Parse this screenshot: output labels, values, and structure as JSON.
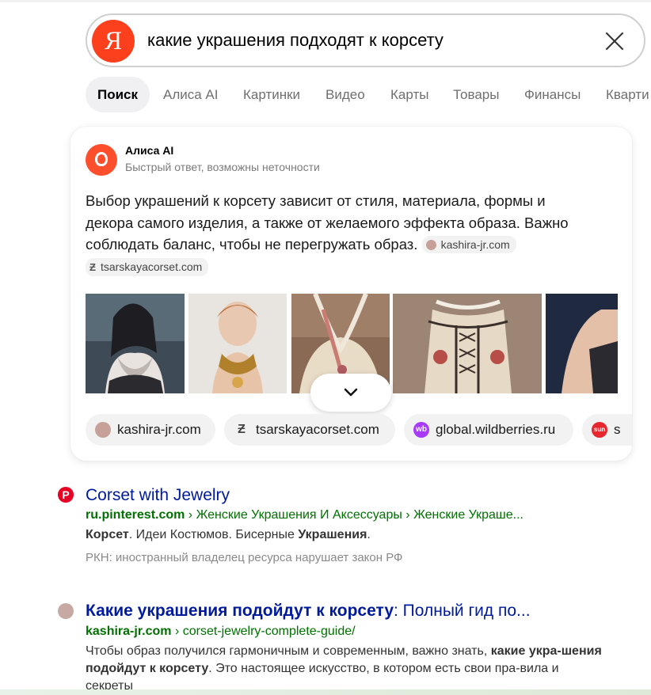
{
  "search": {
    "logo": "Я",
    "query": "какие украшения подходят к корсету"
  },
  "tabs": [
    "Поиск",
    "Алиса AI",
    "Картинки",
    "Видео",
    "Карты",
    "Товары",
    "Финансы",
    "Кварти"
  ],
  "alice": {
    "title": "Алиса AI",
    "subtitle": "Быстрый ответ, возможны неточности",
    "answer": "Выбор украшений к корсету зависит от стиля, материала, формы и декора самого изделия, а также от желаемого эффекта образа. Важно соблюдать баланс, чтобы не перегружать образ.",
    "inline_sources": [
      "kashira-jr.com",
      "tsarskayacorset.com"
    ],
    "sources": [
      "kashira-jr.com",
      "tsarskayacorset.com",
      "global.wildberries.ru",
      "s"
    ],
    "source_icons": [
      "kashira-favicon",
      "z-logo-icon",
      "wb-icon",
      "sunlight-icon"
    ],
    "source_icon_text": [
      "",
      "Ƶ",
      "wb",
      "sun"
    ]
  },
  "results": [
    {
      "icon": "pinterest-icon",
      "icon_text": "P",
      "title": "Corset with Jewelry",
      "url_domain": "ru.pinterest.com",
      "url_path": " › Женские Украшения И Аксессуары › Женские Украше...",
      "snippet_parts": [
        "Корсет",
        ". Идеи Костюмов. Бисерные ",
        "Украшения",
        "."
      ],
      "note": "РКН: иностранный владелец ресурса нарушает закон РФ"
    },
    {
      "icon": "kashira-icon",
      "title_bold": "Какие украшения подойдут к корсету",
      "title_rest": ": Полный гид по...",
      "url_domain": "kashira-jr.com",
      "url_path": " › corset-jewelry-complete-guide/",
      "snippet_parts": [
        "Чтобы образ получился гармоничным и современным, важно знать, ",
        "какие укра-шения подойдут к корсету",
        ". Это настоящее искусство, в котором есть свои пра-вила и секреты"
      ]
    }
  ],
  "colors": {
    "yandex_red": "#fc3f1d",
    "link_blue": "#001a9c",
    "url_green": "#007000",
    "pinterest_red": "#e60023",
    "wildberries_purple": "#a73afd"
  }
}
